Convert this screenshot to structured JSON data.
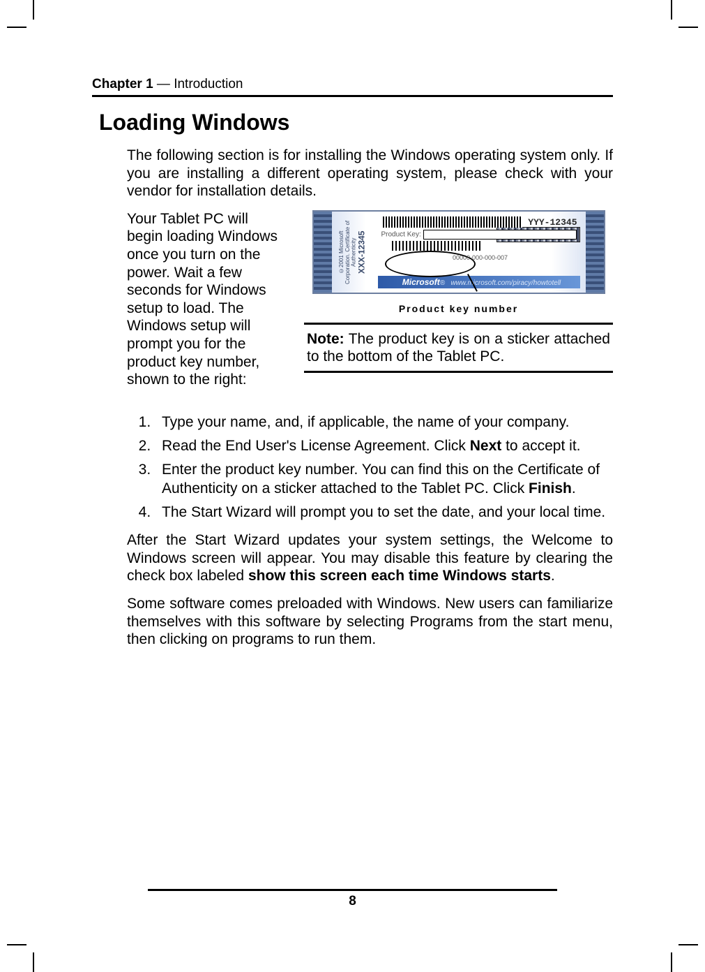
{
  "header": {
    "chapter_label": "Chapter 1",
    "chapter_title": " — Introduction"
  },
  "section_title": "Loading Windows",
  "intro": "The following section is for installing the Windows operating system only. If you are installing a different operating system, please check with your vendor for installation details.",
  "left_paragraph": "Your Tablet PC will begin loading Windows once you turn on the power. Wait a few seconds for Windows setup to load. The Windows setup will prompt you for the product key number, shown to the right:",
  "coa": {
    "side_text_bold": "XXX-12345",
    "side_text_small": "©2001 Microsoft Corporation. Certificate of Authenticity",
    "yyy": "YYY-12345",
    "product_key_label": "Product Key:",
    "serial_text": "00000-000-000-007",
    "ms_brand": "Microsoft",
    "ms_url": "www.microsoft.com/piracy/howtotell"
  },
  "caption": "Product key number",
  "note": {
    "label": "Note:",
    "text": " The product key is on a sticker attached to the bottom of the Tablet PC."
  },
  "steps": [
    "Type your name, and, if applicable, the name of your company.",
    "Read the End User's License Agreement. Click <b>Next</b> to accept it.",
    "Enter the product key number. You can find this on the Certificate of Authenticity on a sticker attached to the Tablet PC. Click <b>Finish</b>.",
    "The Start Wizard will prompt you to set the date, and your local time."
  ],
  "after_para": "After the Start Wizard updates your system settings, the Welcome to Windows screen will appear. You may disable this feature by clearing the check box labeled <b>show this screen each time Windows starts</b>.",
  "preloaded_para": "Some software comes preloaded with Windows. New users can familiarize themselves with this software by selecting Programs from the start menu, then clicking on programs to run them.",
  "page_number": "8"
}
